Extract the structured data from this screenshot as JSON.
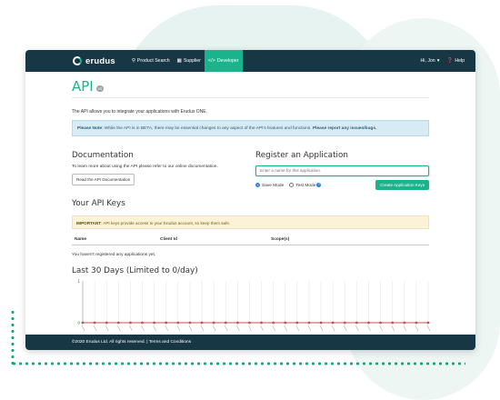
{
  "brand": {
    "name": "erudus",
    "accent": "#1bb38c",
    "navy": "#173745"
  },
  "nav": {
    "items": [
      {
        "label": "Product Search",
        "icon": "search-icon"
      },
      {
        "label": "Supplier",
        "icon": "grid-icon"
      },
      {
        "label": "Developer",
        "icon": "code-icon",
        "active": true
      }
    ],
    "user": "Hi, Jon",
    "help": "Help"
  },
  "page": {
    "title": "API",
    "version": "v1",
    "intro": "The API allows you to integrate your applications with Erudus ONE.",
    "note_label": "Please Note",
    "note_text": ": While the API is in BETA, there may be essential changes to any aspect of the API's features and functions.",
    "note_link": "Please report any issues/bugs."
  },
  "documentation": {
    "heading": "Documentation",
    "text": "To learn more about using the API please refer to our online documentation.",
    "button": "Read the API Documentation"
  },
  "register": {
    "heading": "Register an Application",
    "placeholder": "Enter a name for this application.",
    "save_mode": "Save Mode",
    "test_mode": "Test Mode",
    "button": "Create Application Keys"
  },
  "keys": {
    "heading": "Your API Keys",
    "warning_label": "IMPORTANT",
    "warning_text": ": API keys provide access to your Erudus account, so keep them safe.",
    "columns": [
      "Name",
      "Client Id",
      "Scope(s)"
    ],
    "empty": "You haven't registered any applications yet."
  },
  "usage": {
    "heading": "Last 30 Days (Limited to 0/day)"
  },
  "chart_data": {
    "type": "line",
    "title": "Last 30 Days (Limited to 0/day)",
    "ylim": [
      0,
      1
    ],
    "yticks": [
      "0",
      "1"
    ],
    "points": 30,
    "values": [
      0,
      0,
      0,
      0,
      0,
      0,
      0,
      0,
      0,
      0,
      0,
      0,
      0,
      0,
      0,
      0,
      0,
      0,
      0,
      0,
      0,
      0,
      0,
      0,
      0,
      0,
      0,
      0,
      0,
      0
    ],
    "series_color": "#c9504c",
    "grid": true
  },
  "footer": {
    "copyright": "©2020 Erudus Ltd. All rights reserved.",
    "separator": "|",
    "terms": "Terms and Conditions"
  }
}
